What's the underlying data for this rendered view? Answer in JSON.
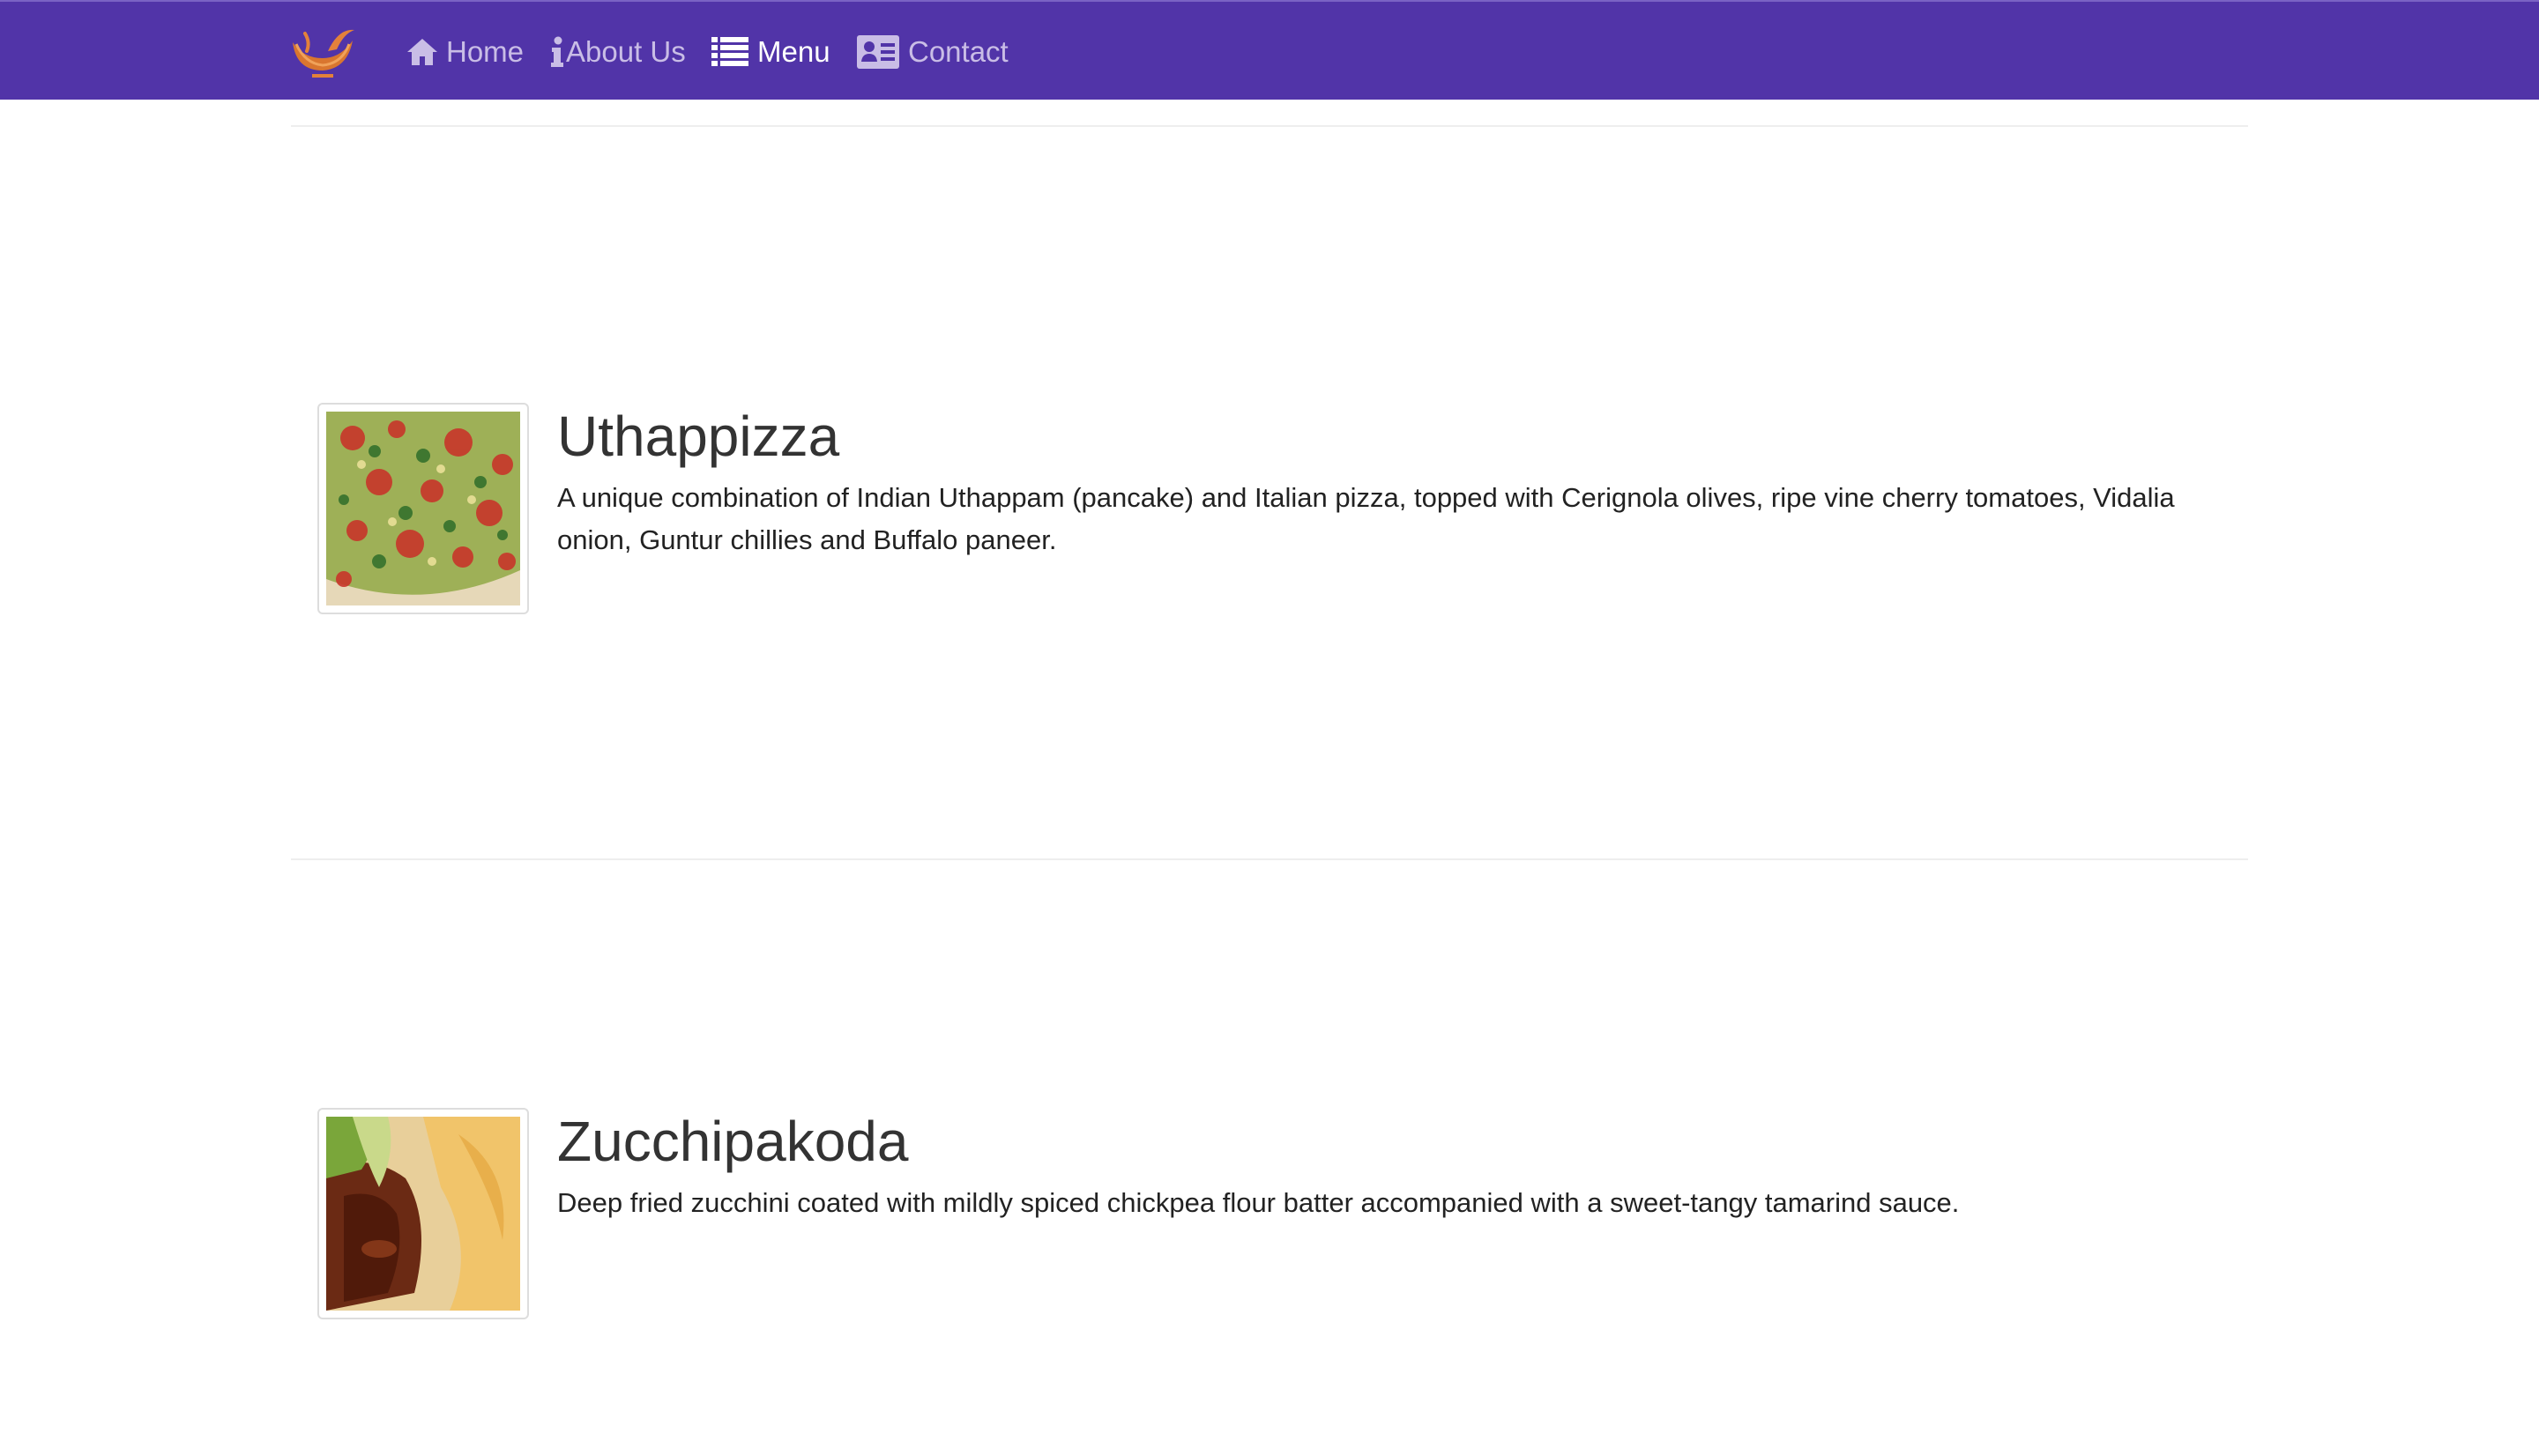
{
  "nav": {
    "items": [
      {
        "label": "Home",
        "icon": "home-icon"
      },
      {
        "label": "About Us",
        "icon": "info-icon"
      },
      {
        "label": "Menu",
        "icon": "list-icon",
        "active": true
      },
      {
        "label": "Contact",
        "icon": "address-card-icon"
      }
    ]
  },
  "dishes": [
    {
      "name": "Uthappizza",
      "description": "A unique combination of Indian Uthappam (pancake) and Italian pizza, topped with Cerignola olives, ripe vine cherry tomatoes, Vidalia onion, Guntur chillies and Buffalo paneer."
    },
    {
      "name": "Zucchipakoda",
      "description": "Deep fried zucchini coated with mildly spiced chickpea flour batter accompanied with a sweet-tangy tamarind sauce."
    }
  ],
  "colors": {
    "navbar": "#5134a8",
    "nav_text": "#c9bde6",
    "nav_active": "#ffffff",
    "logo": "#e3813a"
  }
}
